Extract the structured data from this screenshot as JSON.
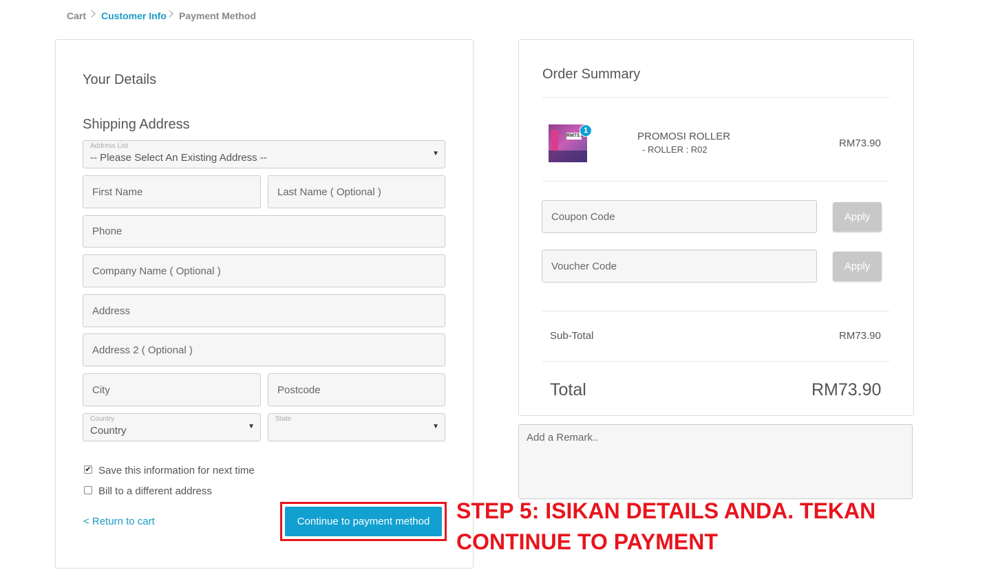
{
  "breadcrumb": {
    "cart": "Cart",
    "customer_info": "Customer Info",
    "payment_method": "Payment Method"
  },
  "details": {
    "title": "Your Details",
    "shipping_title": "Shipping Address",
    "address_list_label": "Address List",
    "address_list_value": "-- Please Select An Existing Address --",
    "first_name_placeholder": "First Name",
    "last_name_placeholder": "Last Name ( Optional )",
    "phone_placeholder": "Phone",
    "company_placeholder": "Company Name ( Optional )",
    "address_placeholder": "Address",
    "address2_placeholder": "Address 2 ( Optional )",
    "city_placeholder": "City",
    "postcode_placeholder": "Postcode",
    "country_label": "Country",
    "country_value": "Country",
    "state_label": "State",
    "state_value": "",
    "save_info_label": "Save this information for next time",
    "save_info_checked": true,
    "bill_different_label": "Bill to a different address",
    "bill_different_checked": false,
    "return_link": "< Return to cart",
    "continue_button": "Continue to payment method"
  },
  "order": {
    "title": "Order Summary",
    "item": {
      "name": "PROMOSI ROLLER",
      "variant": "- ROLLER : R02",
      "price": "RM73.90",
      "quantity": "1",
      "thumb_price": "RM73.90"
    },
    "coupon_placeholder": "Coupon Code",
    "voucher_placeholder": "Voucher Code",
    "apply_label": "Apply",
    "subtotal_label": "Sub-Total",
    "subtotal_value": "RM73.90",
    "total_label": "Total",
    "total_value": "RM73.90"
  },
  "remark_placeholder": "Add a Remark..",
  "annotation": {
    "line1": "STEP 5: ISIKAN DETAILS ANDA. TEKAN",
    "line2": "CONTINUE TO PAYMENT"
  },
  "colors": {
    "accent": "#11a0d0",
    "annotation_red": "#e8141d",
    "apply_gray": "#c8c8c8"
  }
}
